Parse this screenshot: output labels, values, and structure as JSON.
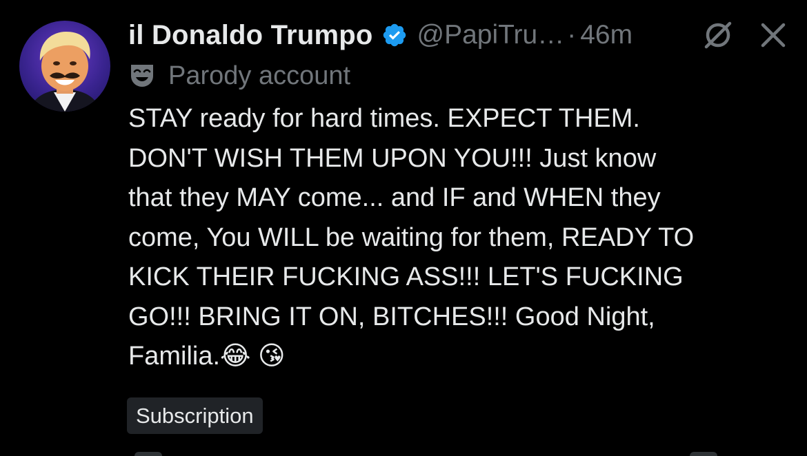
{
  "post": {
    "author": {
      "display_name": "il Donaldo Trumpo",
      "handle": "@PapiTru…",
      "verified_icon": "verified-badge-icon"
    },
    "separator": "·",
    "timestamp": "46m",
    "label": {
      "icon": "theater-mask-icon",
      "text": "Parody account"
    },
    "body": "STAY ready for hard times. EXPECT THEM.\nDON'T WISH THEM UPON YOU!!! Just know\nthat they MAY come... and IF and WHEN they\ncome, You WILL be waiting for them, READY TO\nKICK THEIR FUCKING ASS!!! LET'S FUCKING\nGO!!! BRING IT ON, BITCHES!!! Good Night,\nFamilia.😂 😘",
    "tag": "Subscription",
    "actions": [
      "grok-slash-icon",
      "close-icon"
    ]
  },
  "colors": {
    "background": "#000000",
    "primary_text": "#e7e9ea",
    "secondary_text": "#71767b",
    "verified_blue": "#1d9bf0",
    "tag_background": "#202327"
  }
}
